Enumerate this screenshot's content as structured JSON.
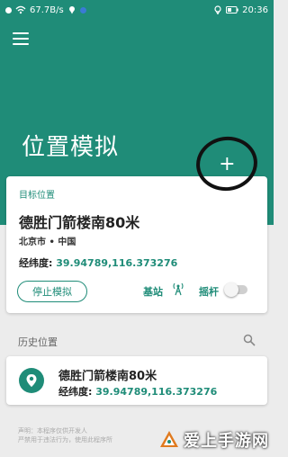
{
  "status_bar": {
    "speed": "67.7B/s",
    "time": "20:36",
    "battery": "19"
  },
  "header": {
    "title": "位置模拟",
    "fab_symbol": "+"
  },
  "target": {
    "section_label": "目标位置",
    "name": "德胜门箭楼南80米",
    "region": "北京市 • 中国",
    "coords_label": "经纬度:",
    "coords_value": "39.94789,116.373276",
    "stop_label": "停止模拟",
    "station_label": "基站",
    "joystick_label": "摇杆",
    "joystick_on": false
  },
  "history": {
    "section_label": "历史位置",
    "items": [
      {
        "name": "德胜门箭楼南80米",
        "coords_label": "经纬度:",
        "coords_value": "39.94789,116.373276"
      }
    ]
  },
  "footer": {
    "line1": "声明：本程序仅供开发人",
    "line2": "严禁用于违法行为，使用此程序所"
  },
  "watermark": {
    "text": "爱上手游网"
  },
  "colors": {
    "accent": "#1f8c78",
    "background": "#ececec"
  }
}
